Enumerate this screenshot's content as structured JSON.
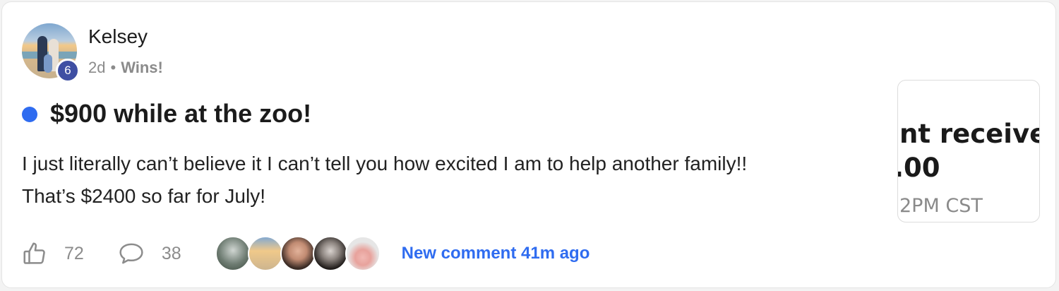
{
  "post": {
    "author": "Kelsey",
    "author_level": "6",
    "time_ago": "2d",
    "separator": "•",
    "category": "Wins!",
    "title": "$900 while at the zoo!",
    "body_lines": [
      "I just literally can’t believe it I can’t tell you how excited I am to help another family!!",
      "That’s $2400 so far for July!"
    ],
    "unread": true
  },
  "thumbnail": {
    "lines": [
      "nt receive",
      ".00",
      "2PM CST"
    ]
  },
  "actions": {
    "like_icon": "thumbs-up-icon",
    "like_count": "72",
    "comment_icon": "speech-bubble-icon",
    "comment_count": "38",
    "commenter_avatars": 5,
    "new_comment_text": "New comment 41m ago"
  },
  "colors": {
    "accent": "#2f6cf0",
    "badge": "#3f4fa3",
    "muted_text": "#8b8b8b"
  }
}
